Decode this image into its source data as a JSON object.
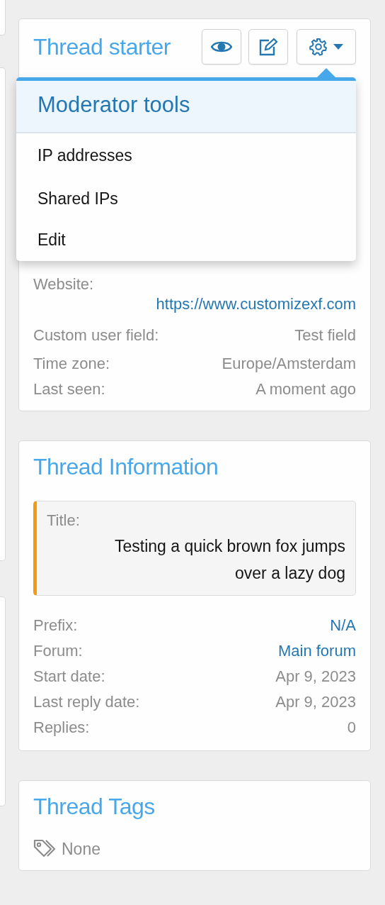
{
  "thread_starter": {
    "title": "Thread starter",
    "buttons": [
      {
        "kind": "view"
      },
      {
        "kind": "edit"
      },
      {
        "kind": "settings"
      }
    ],
    "field_groups": [
      [
        {
          "label": "Website:",
          "url": "https://www.customizexf.com",
          "kind": "link_block"
        },
        {
          "label": "Custom user field:",
          "value": "Test field",
          "kind": "text"
        }
      ],
      [
        {
          "label": "Time zone:",
          "value": "Europe/Amsterdam",
          "kind": "text"
        },
        {
          "label": "Last seen:",
          "value": "A moment ago",
          "kind": "text"
        }
      ]
    ]
  },
  "moderator_menu": {
    "title": "Moderator tools",
    "items": [
      "IP addresses",
      "Shared IPs",
      "Edit"
    ]
  },
  "thread_information": {
    "title": "Thread Information",
    "quote_label": "Title:",
    "quote_value": "Testing a quick brown fox jumps over a lazy dog",
    "fields": [
      {
        "label": "Prefix:",
        "value": "N/A",
        "kind": "link"
      },
      {
        "label": "Forum:",
        "value": "Main forum",
        "kind": "link"
      },
      {
        "label": "Start date:",
        "value": "Apr 9, 2023",
        "kind": "text"
      },
      {
        "label": "Last reply date:",
        "value": "Apr 9, 2023",
        "kind": "text"
      },
      {
        "label": "Replies:",
        "value": "0",
        "kind": "text"
      }
    ]
  },
  "thread_tags": {
    "title": "Thread Tags",
    "empty_text": "None"
  }
}
